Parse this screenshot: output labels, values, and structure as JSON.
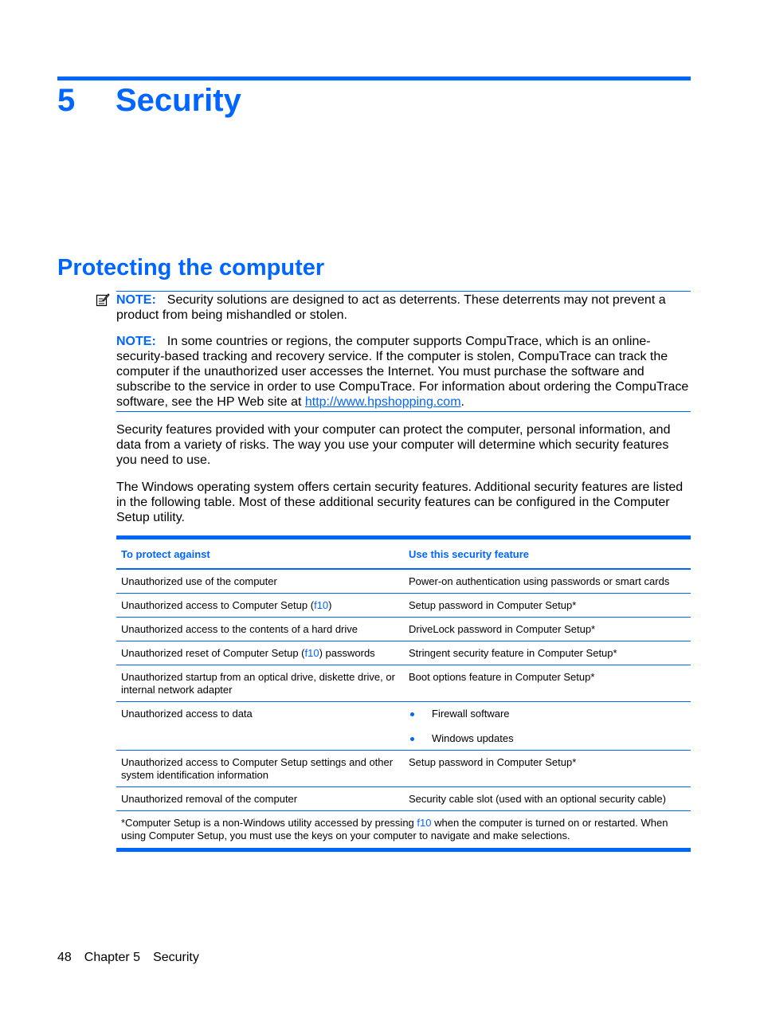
{
  "chapter": {
    "number": "5",
    "title": "Security"
  },
  "section": {
    "title": "Protecting the computer"
  },
  "notes": [
    {
      "label": "NOTE:",
      "text": "Security solutions are designed to act as deterrents. These deterrents may not prevent a product from being mishandled or stolen."
    },
    {
      "label": "NOTE:",
      "text_before_link": "In some countries or regions, the computer supports CompuTrace, which is an online-security-based tracking and recovery service. If the computer is stolen, CompuTrace can track the computer if the unauthorized user accesses the Internet. You must purchase the software and subscribe to the service in order to use CompuTrace. For information about ordering the CompuTrace software, see the HP Web site at ",
      "link": "http://www.hpshopping.com",
      "text_after_link": "."
    }
  ],
  "paragraphs": [
    "Security features provided with your computer can protect the computer, personal information, and data from a variety of risks. The way you use your computer will determine which security features you need to use.",
    "The Windows operating system offers certain security features. Additional security features are listed in the following table. Most of these additional security features can be configured in the Computer Setup utility."
  ],
  "table": {
    "headers": [
      "To protect against",
      "Use this security feature"
    ],
    "rows": [
      {
        "threat": "Unauthorized use of the computer",
        "feature": "Power-on authentication using passwords or smart cards"
      },
      {
        "threat_before": "Unauthorized access to Computer Setup (",
        "threat_key": "f10",
        "threat_after": ")",
        "feature": "Setup password in Computer Setup*"
      },
      {
        "threat": "Unauthorized access to the contents of a hard drive",
        "feature": "DriveLock password in Computer Setup*"
      },
      {
        "threat_before": "Unauthorized reset of Computer Setup (",
        "threat_key": "f10",
        "threat_after": ") passwords",
        "feature": "Stringent security feature in Computer Setup*"
      },
      {
        "threat": "Unauthorized startup from an optical drive, diskette drive, or internal network adapter",
        "feature": "Boot options feature in Computer Setup*"
      },
      {
        "threat": "Unauthorized access to data",
        "feature_list": [
          "Firewall software",
          "Windows updates"
        ]
      },
      {
        "threat": "Unauthorized access to Computer Setup settings and other system identification information",
        "feature": "Setup password in Computer Setup*"
      },
      {
        "threat": "Unauthorized removal of the computer",
        "feature": "Security cable slot (used with an optional security cable)"
      }
    ],
    "footnote_before": "*Computer Setup is a non-Windows utility accessed by pressing ",
    "footnote_key": "f10",
    "footnote_after": " when the computer is turned on or restarted. When using Computer Setup, you must use the keys on your computer to navigate and make selections."
  },
  "footer": {
    "page_number": "48",
    "chapter_label": "Chapter 5",
    "chapter_name": "Security"
  }
}
